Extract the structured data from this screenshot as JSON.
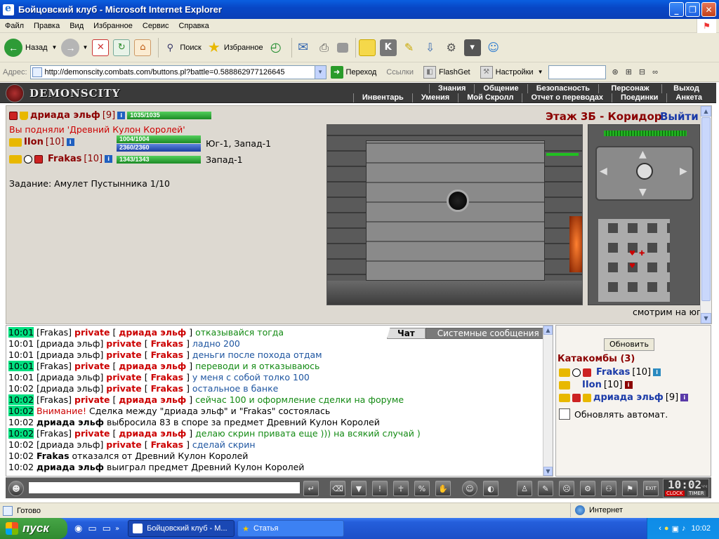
{
  "window": {
    "title": "Бойцовский клуб - Microsoft Internet Explorer"
  },
  "menu": [
    "Файл",
    "Правка",
    "Вид",
    "Избранное",
    "Сервис",
    "Справка"
  ],
  "toolbar": {
    "back": "Назад",
    "search": "Поиск",
    "favorites": "Избранное"
  },
  "address": {
    "label": "Адрес:",
    "url": "http://demonscity.combats.com/buttons.pl?battle=0.588862977126645",
    "go": "Переход",
    "links": "Ссылки",
    "flashget": "FlashGet",
    "settings": "Настройки"
  },
  "game": {
    "logo": "DEMONSCITY",
    "nav_top": [
      "Знания",
      "Общение",
      "Безопасность",
      "Персонаж",
      "Выход"
    ],
    "nav_bottom": [
      "Инвентарь",
      "Умения",
      "Мой Скролл",
      "Отчет о переводах",
      "Поединки",
      "Анкета"
    ],
    "location": "Этаж 3Б - Коридор",
    "exit": "Выйти",
    "player": {
      "name": "дриада эльф",
      "level": "[9]",
      "hp": "1035/1035"
    },
    "event": "Вы подняли 'Древний Кулон Королей'",
    "party": [
      {
        "name": "IIon",
        "level": "[10]",
        "hp": "1004/1004",
        "mana": "2360/2360",
        "dir": "Юг-1, Запад-1"
      },
      {
        "name": "Frakas",
        "level": "[10]",
        "hp": "1343/1343",
        "dir": "Запад-1"
      }
    ],
    "quest": "Задание: Амулет Пустынника 1/10",
    "looking": "смотрим на юг"
  },
  "chat": {
    "tabs": [
      "Чат",
      "Системные сообщения"
    ],
    "lines": [
      {
        "t": "10:01",
        "hl": true,
        "from": "Frakas",
        "to": "дриада эльф",
        "msg": "отказывайся тогда",
        "c": "msgG"
      },
      {
        "t": "10:01",
        "hl": false,
        "from": "дриада эльф",
        "to": "Frakas",
        "msg": "ладно 200",
        "c": "msgB"
      },
      {
        "t": "10:01",
        "hl": false,
        "from": "дриада эльф",
        "to": "Frakas",
        "msg": "деньги после похода отдам",
        "c": "msgB"
      },
      {
        "t": "10:01",
        "hl": true,
        "from": "Frakas",
        "to": "дриада эльф",
        "msg": "переводи и я отказываюсь",
        "c": "msgG"
      },
      {
        "t": "10:01",
        "hl": false,
        "from": "дриада эльф",
        "to": "Frakas",
        "msg": "у меня с собой толко 100",
        "c": "msgB"
      },
      {
        "t": "10:02",
        "hl": false,
        "from": "дриада эльф",
        "to": "Frakas",
        "msg": "остальное в банке",
        "c": "msgB"
      },
      {
        "t": "10:02",
        "hl": true,
        "from": "Frakas",
        "to": "дриада эльф",
        "msg": "сейчас 100 и оформление сделки на форуме",
        "c": "msgG"
      }
    ],
    "sys1": {
      "t": "10:02",
      "warn": "Внимание!",
      "text": "Сделка между \"дриада эльф\" и \"Frakas\" состоялась"
    },
    "sys2": {
      "t": "10:02",
      "who": "дриада эльф",
      "text": "выбросила 83 в споре за предмет Древний Кулон Королей"
    },
    "line12": {
      "t": "10:02",
      "from": "Frakas",
      "to": "дриада эльф",
      "msg": "делаю скрин привата еще ))) на всякий случай )"
    },
    "line13": {
      "t": "10:02",
      "from": "дриада эльф",
      "to": "Frakas",
      "msg": "сделай скрин"
    },
    "sys3": {
      "t": "10:02",
      "who": "Frakas",
      "text": "отказался от Древний Кулон Королей"
    },
    "sys4": {
      "t": "10:02",
      "who": "дриада эльф",
      "text": "выиграл предмет Древний Кулон Королей"
    },
    "private": "private"
  },
  "room": {
    "refresh": "Обновить",
    "title": "Катакомбы (3)",
    "members": [
      {
        "name": "Frakas",
        "level": "[10]"
      },
      {
        "name": "IIon",
        "level": "[10]"
      },
      {
        "name": "дриада эльф",
        "level": "[9]"
      }
    ],
    "auto": "Обновлять автомат."
  },
  "clock": {
    "time": "10:02",
    "unit": "чч",
    "clock": "CLOCK",
    "timer": "TIMER"
  },
  "status": {
    "ready": "Готово",
    "zone": "Интернет"
  },
  "taskbar": {
    "start": "пуск",
    "tasks": [
      "Бойцовский клуб - M...",
      "Статья"
    ],
    "time": "10:02"
  }
}
